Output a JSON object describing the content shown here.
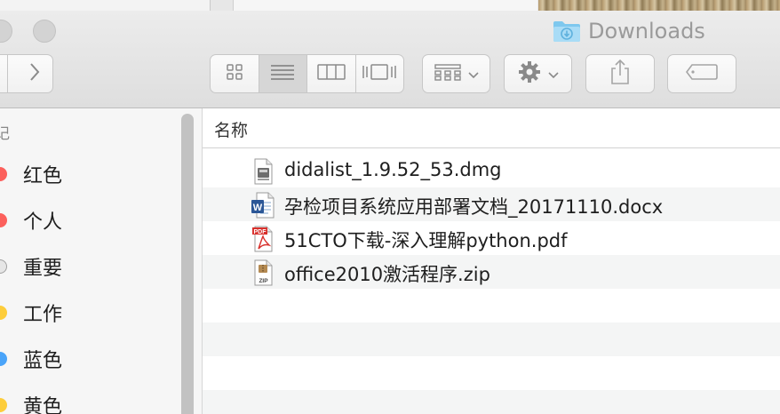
{
  "window": {
    "title": "Downloads",
    "folder_icon": "downloads-folder-icon",
    "accent_folder_color": "#6bbfe8"
  },
  "toolbar": {
    "forward_icon": "chevron-right-icon",
    "view_modes": [
      "icon-view-icon",
      "list-view-icon",
      "column-view-icon",
      "cover-flow-icon"
    ],
    "active_view": "list-view-icon",
    "arrange_icon": "arrange-grid-icon",
    "action_icon": "gear-icon",
    "share_icon": "share-icon",
    "tag_icon": "tag-icon"
  },
  "sidebar": {
    "section_fragment": "记",
    "tags": [
      {
        "label": "红色",
        "color": "#fc605c"
      },
      {
        "label": "个人",
        "color": "#fc605c"
      },
      {
        "label": "重要",
        "color": "#e0e0e0"
      },
      {
        "label": "工作",
        "color": "#fdcd3b"
      },
      {
        "label": "蓝色",
        "color": "#4aa4f9"
      },
      {
        "label": "黄色",
        "color": "#fdcd3b"
      }
    ]
  },
  "filelist": {
    "column_name": "名称",
    "files": [
      {
        "name": "didalist_1.9.52_53.dmg",
        "icon": "dmg-disk-image-icon"
      },
      {
        "name": "孕检项目系统应用部署文档_20171110.docx",
        "icon": "word-document-icon"
      },
      {
        "name": "51CTO下载-深入理解python.pdf",
        "icon": "pdf-document-icon"
      },
      {
        "name": "office2010激活程序.zip",
        "icon": "zip-archive-icon"
      }
    ]
  }
}
